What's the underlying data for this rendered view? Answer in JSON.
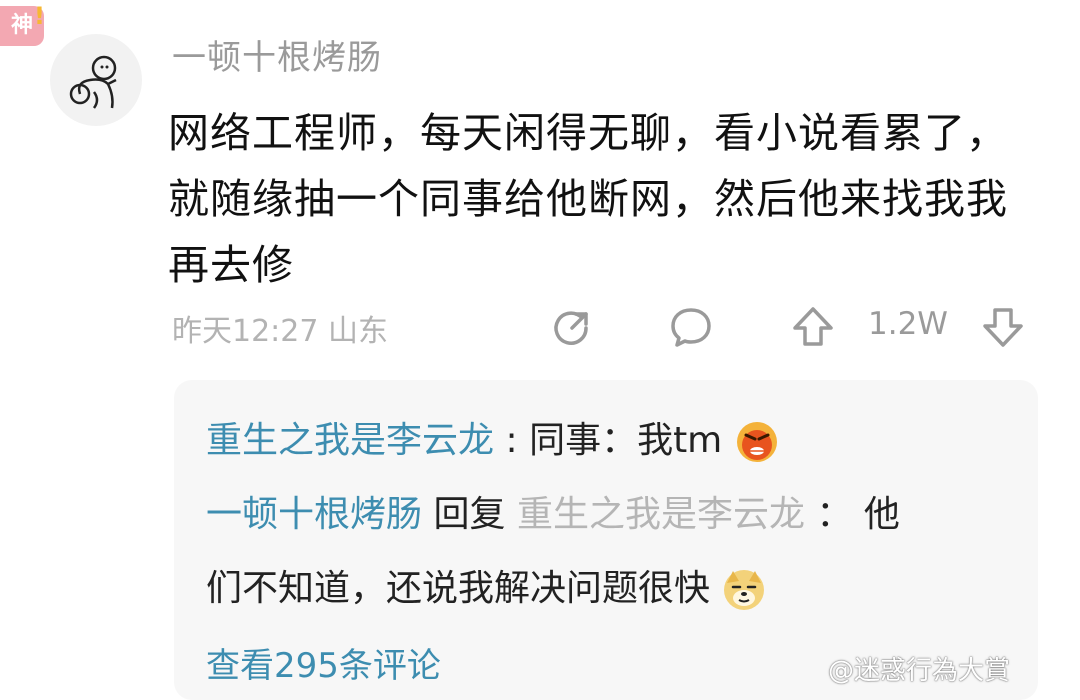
{
  "badge": {
    "label": "神",
    "mark": "!"
  },
  "post": {
    "username": "一顿十根烤肠",
    "content": "网络工程师，每天闲得无聊，看小说看累了，就随缘抽一个同事给他断网，然后他来找我我再去修",
    "time": "昨天12:27",
    "location": "山东",
    "like_count": "1.2W"
  },
  "actions": {
    "share_icon": "share-icon",
    "comment_icon": "comment-icon",
    "upvote_icon": "upvote-icon",
    "downvote_icon": "downvote-icon"
  },
  "replies": [
    {
      "author": "重生之我是李云龙",
      "sep": ":",
      "text": "同事：我tm",
      "emoji": "angry-face-emoji"
    },
    {
      "author": "一顿十根烤肠",
      "reply_word": "回复",
      "target": "重生之我是李云龙",
      "sep": "：",
      "text_line1": "他",
      "text_line2": "们不知道，还说我解决问题很快",
      "emoji": "doge-emoji"
    }
  ],
  "view_more": "查看295条评论",
  "watermark": "@迷惑行為大賞"
}
